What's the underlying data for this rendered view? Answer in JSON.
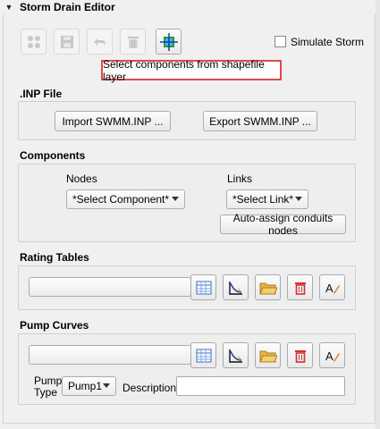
{
  "header": {
    "title": "Storm Drain Editor"
  },
  "toolbar": {
    "simulate_label": "Simulate Storm",
    "hint": "Select components from shapefile layer"
  },
  "inp": {
    "title": ".INP File",
    "import_label": "Import SWMM.INP ...",
    "export_label": "Export SWMM.INP ..."
  },
  "components": {
    "title": "Components",
    "nodes_label": "Nodes",
    "links_label": "Links",
    "nodes_value": "*Select Component*",
    "links_value": "*Select Link*",
    "auto_assign_label": "Auto-assign conduits nodes"
  },
  "rating": {
    "title": "Rating Tables"
  },
  "pump": {
    "title": "Pump Curves",
    "pump_type_label_1": "Pump",
    "pump_type_label_2": "Type",
    "pump_type_value": "Pump1",
    "description_label": "Description"
  },
  "colors": {
    "hint_border": "#e04a4a",
    "accent_red": "#d22f2f",
    "folder": "#e7b24a"
  }
}
